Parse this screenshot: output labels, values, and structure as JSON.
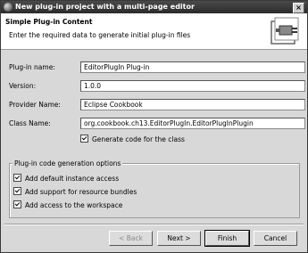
{
  "window": {
    "title": "New plug-in project with a multi-page editor",
    "close_glyph": "×"
  },
  "header": {
    "title": "Simple Plug-in Content",
    "description": "Enter the required data to generate initial plug-in files",
    "icon": "plugin-wizard-icon"
  },
  "form": {
    "plugin_name": {
      "label": "Plug-in name:",
      "value": "EditorPlugIn Plug-in"
    },
    "version": {
      "label": "Version:",
      "value": "1.0.0"
    },
    "provider_name": {
      "label": "Provider Name:",
      "value": "Eclipse Cookbook"
    },
    "class_name": {
      "label": "Class Name:",
      "value": "org.cookbook.ch13.EditorPlugIn.EditorPlugInPlugin"
    },
    "generate_code": {
      "label": "Generate code for the class",
      "checked": true
    }
  },
  "options": {
    "group_label": "Plug-in code generation options",
    "items": [
      {
        "label": "Add default instance access",
        "checked": true
      },
      {
        "label": "Add support for resource bundles",
        "checked": true
      },
      {
        "label": "Add access to the workspace",
        "checked": true
      }
    ]
  },
  "buttons": {
    "back": "< Back",
    "next": "Next >",
    "finish": "Finish",
    "cancel": "Cancel"
  }
}
